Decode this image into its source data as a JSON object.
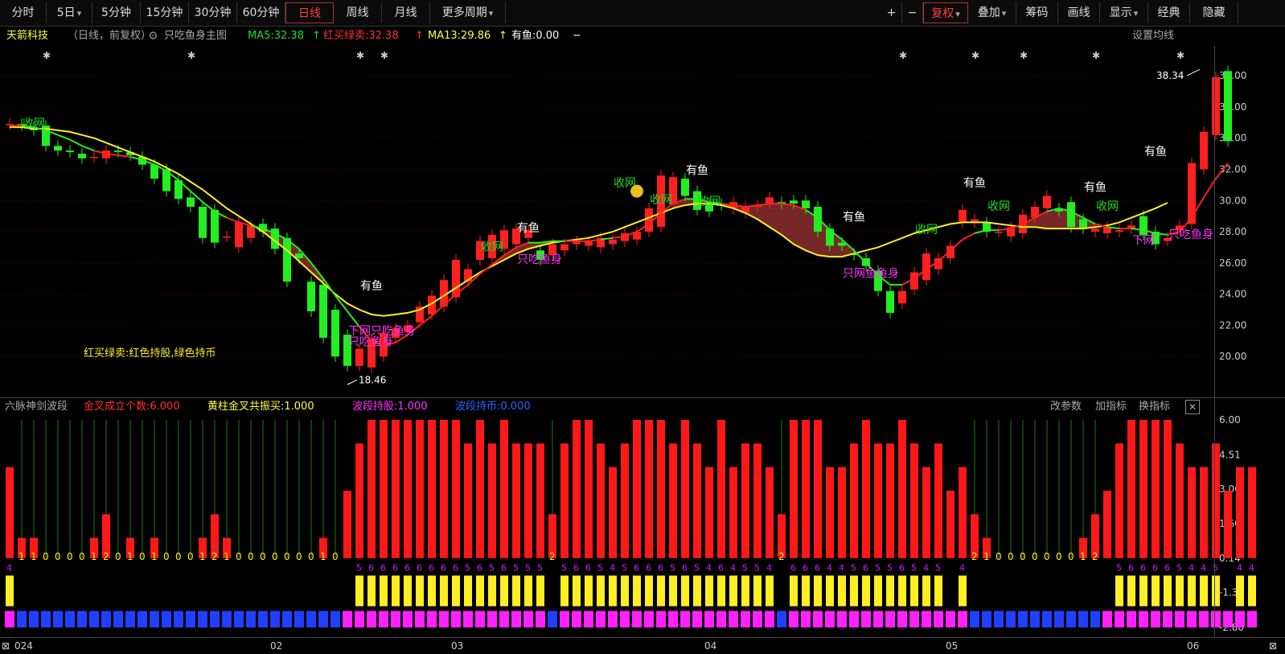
{
  "toolbar": {
    "left_items": [
      "分时",
      "5日",
      "5分钟",
      "15分钟",
      "30分钟",
      "60分钟",
      "日线",
      "周线",
      "月线",
      "更多周期"
    ],
    "active": "日线",
    "right_items": [
      "+",
      "−",
      "复权",
      "叠加",
      "筹码",
      "画线",
      "显示",
      "经典",
      "隐藏"
    ],
    "right_active": "复权"
  },
  "header": {
    "stock_name": "天箭科技",
    "period": "（日线，前复权）",
    "gear_icon": "gear-icon",
    "indicator_name": "只吃鱼身主图",
    "ma5": "MA5:32.38",
    "hongmai": "红买绿卖:32.38",
    "ma13": "MA13:29.86",
    "youyu": "有鱼:0.00",
    "dash": "−",
    "set_ma": "设置均线"
  },
  "main_chart": {
    "price_labels": [
      "38.00",
      "36.00",
      "34.00",
      "32.00",
      "30.00",
      "28.00",
      "26.00",
      "24.00",
      "22.00",
      "20.00"
    ],
    "price_values": [
      38,
      36,
      34,
      32,
      30,
      28,
      26,
      24,
      22,
      20
    ],
    "high_label": "38.34",
    "low_label": "18.46",
    "legend_text": "红买绿卖:红色持股,绿色持币",
    "annotations": [
      {
        "text": "收网",
        "i": 2,
        "p": 34.7,
        "color": "#22dd22"
      },
      {
        "text": "有鱼",
        "i": 30,
        "p": 24.3,
        "color": "#ffffff"
      },
      {
        "text": "下网只吃鱼身",
        "i": 29,
        "p": 21.4,
        "color": "#ff33ff"
      },
      {
        "text": "只吃鱼身",
        "i": 29,
        "p": 20.7,
        "color": "#ff33ff"
      },
      {
        "text": "有鱼",
        "i": 43,
        "p": 28.0,
        "color": "#ffffff"
      },
      {
        "text": "收网",
        "i": 40,
        "p": 26.8,
        "color": "#22dd22"
      },
      {
        "text": "只吃鱼身",
        "i": 43,
        "p": 26.0,
        "color": "#ff33ff"
      },
      {
        "text": "收网",
        "i": 51,
        "p": 30.9,
        "color": "#22dd22"
      },
      {
        "text": "收网",
        "i": 54,
        "p": 29.8,
        "color": "#22dd22"
      },
      {
        "text": "有鱼",
        "i": 57,
        "p": 31.7,
        "color": "#ffffff"
      },
      {
        "text": "收网",
        "i": 58,
        "p": 29.7,
        "color": "#22dd22"
      },
      {
        "text": "有鱼",
        "i": 70,
        "p": 28.7,
        "color": "#ffffff"
      },
      {
        "text": "只网鱼鱼身",
        "i": 70,
        "p": 25.1,
        "color": "#ff33ff"
      },
      {
        "text": "有鱼",
        "i": 80,
        "p": 30.9,
        "color": "#ffffff"
      },
      {
        "text": "收网",
        "i": 76,
        "p": 27.9,
        "color": "#22dd22"
      },
      {
        "text": "收网",
        "i": 82,
        "p": 29.4,
        "color": "#22dd22"
      },
      {
        "text": "有鱼",
        "i": 90,
        "p": 30.6,
        "color": "#ffffff"
      },
      {
        "text": "收网",
        "i": 91,
        "p": 29.4,
        "color": "#22dd22"
      },
      {
        "text": "有鱼",
        "i": 95,
        "p": 32.9,
        "color": "#ffffff"
      },
      {
        "text": "下网",
        "i": 94,
        "p": 27.2,
        "color": "#ff33ff"
      },
      {
        "text": "只吃鱼身",
        "i": 97,
        "p": 27.6,
        "color": "#ff33ff"
      }
    ],
    "star_positions": [
      3,
      15,
      29,
      31,
      74,
      80,
      84,
      90,
      97
    ]
  },
  "sub_header": {
    "name": "六脉神剑波段",
    "jincha": "金叉成立个数:6.000",
    "huangzhu": "黄柱金叉共振买:1.000",
    "boduan_chigu": "波段持股:1.000",
    "boduan_chibi": "波段持币:0.000",
    "dash": "−",
    "btn_params": "改参数",
    "btn_add": "加指标",
    "btn_switch": "换指标"
  },
  "sub_chart": {
    "y_labels": [
      "6.00",
      "4.51",
      "3.06",
      "1.60",
      "0.14",
      "-1.31",
      "-2.80"
    ],
    "y_values": [
      6.0,
      4.51,
      3.06,
      1.6,
      0.14,
      -1.31,
      -2.8
    ]
  },
  "footer": {
    "dates": [
      "024",
      "02",
      "03",
      "04",
      "05",
      "06"
    ],
    "date_idx": [
      0,
      22,
      37,
      58,
      78,
      98
    ]
  },
  "chart_data": {
    "type": "candlestick",
    "open": [
      34.9,
      34.9,
      34.7,
      34.8,
      33.5,
      33.2,
      33.0,
      32.8,
      32.7,
      33.2,
      33.1,
      32.8,
      32.3,
      32.0,
      31.3,
      30.2,
      29.6,
      29.4,
      27.7,
      27.0,
      27.6,
      28.5,
      28.2,
      27.6,
      26.6,
      24.8,
      24.6,
      23.0,
      21.4,
      19.4,
      19.3,
      20.0,
      21.2,
      21.6,
      22.2,
      22.7,
      23.2,
      23.8,
      24.8,
      26.2,
      26.3,
      26.9,
      27.2,
      27.6,
      26.8,
      26.5,
      26.8,
      27.2,
      27.1,
      27.0,
      27.2,
      27.4,
      27.5,
      28.0,
      28.3,
      29.8,
      31.4,
      30.6,
      29.8,
      29.8,
      29.5,
      29.2,
      29.6,
      29.8,
      29.9,
      30.0,
      30.0,
      29.6,
      28.2,
      27.3,
      26.6,
      26.3,
      25.5,
      24.2,
      23.4,
      24.3,
      24.9,
      25.6,
      26.3,
      28.6,
      28.6,
      28.6,
      28.0,
      27.7,
      27.9,
      28.9,
      29.5,
      29.5,
      29.9,
      28.8,
      28.0,
      27.9,
      28.0,
      28.2,
      29.0,
      28.0,
      27.4,
      28.1,
      28.5,
      32.0,
      34.2,
      38.3
    ],
    "close": [
      34.9,
      34.8,
      34.5,
      33.5,
      33.2,
      33.1,
      32.7,
      32.8,
      33.2,
      33.1,
      32.9,
      32.3,
      31.4,
      30.6,
      30.1,
      29.6,
      27.6,
      27.3,
      27.7,
      28.6,
      28.4,
      28.0,
      26.9,
      24.8,
      26.3,
      22.9,
      21.2,
      20.0,
      19.4,
      20.5,
      21.1,
      21.5,
      21.8,
      22.0,
      23.2,
      23.9,
      24.9,
      26.2,
      25.6,
      27.4,
      27.8,
      28.1,
      28.2,
      28.1,
      26.2,
      27.2,
      27.2,
      27.4,
      27.4,
      27.6,
      27.5,
      27.9,
      28.0,
      29.5,
      31.6,
      31.5,
      30.3,
      29.4,
      29.3,
      29.7,
      29.9,
      29.6,
      29.7,
      30.2,
      29.8,
      29.8,
      29.5,
      28.0,
      27.1,
      27.1,
      26.5,
      25.8,
      24.2,
      22.8,
      24.2,
      25.4,
      26.6,
      26.3,
      27.1,
      29.4,
      28.8,
      28.0,
      28.0,
      28.3,
      29.1,
      29.6,
      30.3,
      29.3,
      28.3,
      28.2,
      28.2,
      28.3,
      28.1,
      28.4,
      27.8,
      27.2,
      27.6,
      28.4,
      32.4,
      34.4,
      37.9,
      33.8
    ],
    "ma5": [
      34.8,
      34.8,
      34.7,
      34.5,
      34.2,
      33.9,
      33.5,
      33.2,
      33.0,
      32.9,
      32.8,
      32.6,
      32.3,
      31.9,
      31.3,
      30.6,
      29.9,
      29.3,
      28.9,
      28.6,
      28.4,
      28.2,
      27.9,
      27.5,
      26.9,
      26.0,
      25.0,
      23.9,
      22.9,
      21.9,
      21.0,
      20.7,
      20.9,
      21.4,
      22.0,
      22.6,
      23.3,
      24.0,
      24.6,
      25.3,
      25.9,
      26.5,
      27.0,
      27.3,
      27.3,
      27.4,
      27.4,
      27.4,
      27.4,
      27.5,
      27.6,
      27.7,
      28.0,
      28.5,
      29.2,
      29.8,
      30.1,
      30.1,
      29.9,
      29.8,
      29.7,
      29.6,
      29.7,
      29.8,
      29.8,
      29.7,
      29.4,
      28.9,
      28.1,
      27.5,
      26.8,
      26.0,
      25.2,
      24.6,
      24.6,
      25.0,
      25.6,
      26.1,
      26.8,
      27.5,
      27.9,
      28.1,
      28.1,
      28.2,
      28.5,
      28.9,
      29.3,
      29.5,
      29.3,
      28.9,
      28.5,
      28.3,
      28.2,
      28.2,
      28.1,
      27.9,
      27.8,
      28.0,
      28.9,
      30.2,
      31.4,
      32.4
    ],
    "ma13": [
      34.7,
      34.7,
      34.6,
      34.6,
      34.5,
      34.4,
      34.2,
      34.0,
      33.7,
      33.4,
      33.1,
      32.8,
      32.5,
      32.1,
      31.7,
      31.2,
      30.7,
      30.1,
      29.5,
      29.0,
      28.5,
      28.0,
      27.4,
      26.8,
      26.1,
      25.4,
      24.7,
      24.0,
      23.4,
      23.0,
      22.7,
      22.6,
      22.7,
      22.8,
      23.0,
      23.4,
      23.9,
      24.4,
      24.9,
      25.4,
      25.8,
      26.2,
      26.6,
      26.9,
      27.1,
      27.3,
      27.4,
      27.5,
      27.6,
      27.8,
      28.0,
      28.3,
      28.6,
      28.9,
      29.2,
      29.5,
      29.7,
      29.8,
      29.8,
      29.7,
      29.5,
      29.2,
      28.8,
      28.3,
      27.8,
      27.2,
      26.8,
      26.5,
      26.4,
      26.4,
      26.6,
      26.8,
      27.0,
      27.3,
      27.6,
      27.9,
      28.1,
      28.3,
      28.5,
      28.6,
      28.6,
      28.6,
      28.5,
      28.4,
      28.3,
      28.3,
      28.2,
      28.2,
      28.2,
      28.2,
      28.3,
      28.4,
      28.6,
      28.9,
      29.2,
      29.5,
      29.86
    ],
    "sub_bars": [
      4,
      1,
      1,
      0,
      0,
      0,
      0,
      1,
      2,
      0,
      1,
      0,
      1,
      0,
      0,
      0,
      1,
      2,
      1,
      0,
      0,
      0,
      0,
      0,
      0,
      0,
      1,
      0,
      3,
      5,
      6,
      6,
      6,
      6,
      6,
      6,
      6,
      6,
      5,
      6,
      5,
      6,
      5,
      5,
      5,
      2,
      5,
      6,
      6,
      5,
      4,
      5,
      6,
      6,
      6,
      5,
      6,
      5,
      4,
      6,
      4,
      5,
      5,
      4,
      2,
      6,
      6,
      6,
      4,
      4,
      5,
      6,
      5,
      5,
      6,
      5,
      4,
      5,
      3,
      4,
      2,
      1,
      0,
      0,
      0,
      0,
      0,
      0,
      0,
      1,
      2,
      3,
      5,
      6,
      6,
      6,
      6,
      5,
      4,
      4,
      5,
      3,
      4,
      4
    ]
  }
}
